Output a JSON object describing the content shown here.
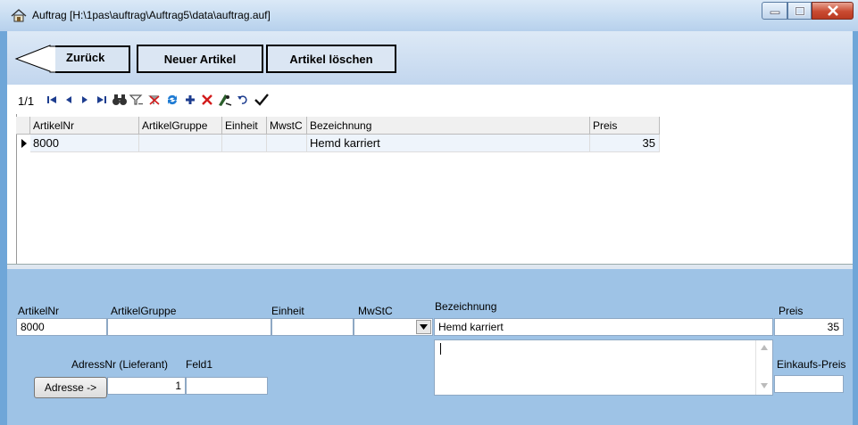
{
  "window": {
    "title": "Auftrag [H:\\1pas\\auftrag\\Auftrag5\\data\\auftrag.auf]",
    "minimize": "–",
    "maximize": "▭",
    "close": "✕"
  },
  "toolbar": {
    "back_label": "Zurück",
    "new_label": "Neuer Artikel",
    "delete_label": "Artikel löschen"
  },
  "navigator": {
    "record_count": "1/1",
    "icons": {
      "first": "first-record-icon",
      "prior": "prior-record-icon",
      "next": "next-record-icon",
      "last": "last-record-icon",
      "search": "binoculars-icon",
      "filter": "filter-icon",
      "clear_filter": "clear-filter-icon",
      "refresh": "refresh-icon",
      "insert": "insert-icon",
      "delete": "delete-icon",
      "edit": "edit-icon",
      "cancel": "undo-icon",
      "post": "checkmark-icon"
    },
    "colors": {
      "nav": "#1d3d8f",
      "insert": "#1d3d8f",
      "delete": "#d21b1b",
      "refresh": "#1f7bd3"
    }
  },
  "grid": {
    "columns": [
      "ArtikelNr",
      "ArtikelGruppe",
      "Einheit",
      "MwstC",
      "Bezeichnung",
      "Preis"
    ],
    "rows": [
      {
        "ArtikelNr": "8000",
        "ArtikelGruppe": "",
        "Einheit": "",
        "MwstC": "",
        "Bezeichnung": "Hemd karriert",
        "Preis": "35"
      }
    ]
  },
  "detail": {
    "labels": {
      "artikelnr": "ArtikelNr",
      "artikelgruppe": "ArtikelGruppe",
      "einheit": "Einheit",
      "mwstc": "MwStC",
      "bezeichnung": "Bezeichnung",
      "preis": "Preis",
      "adressnr": "AdressNr (Lieferant)",
      "feld1": "Feld1",
      "einkaufspreis": "Einkaufs-Preis"
    },
    "values": {
      "artikelnr": "8000",
      "artikelgruppe": "",
      "einheit": "",
      "mwstc": "",
      "bezeichnung": "Hemd karriert",
      "preis": "35",
      "adressnr": "1",
      "feld1": "",
      "memo": "",
      "einkaufspreis": ""
    },
    "adresse_button": "Adresse ->"
  }
}
